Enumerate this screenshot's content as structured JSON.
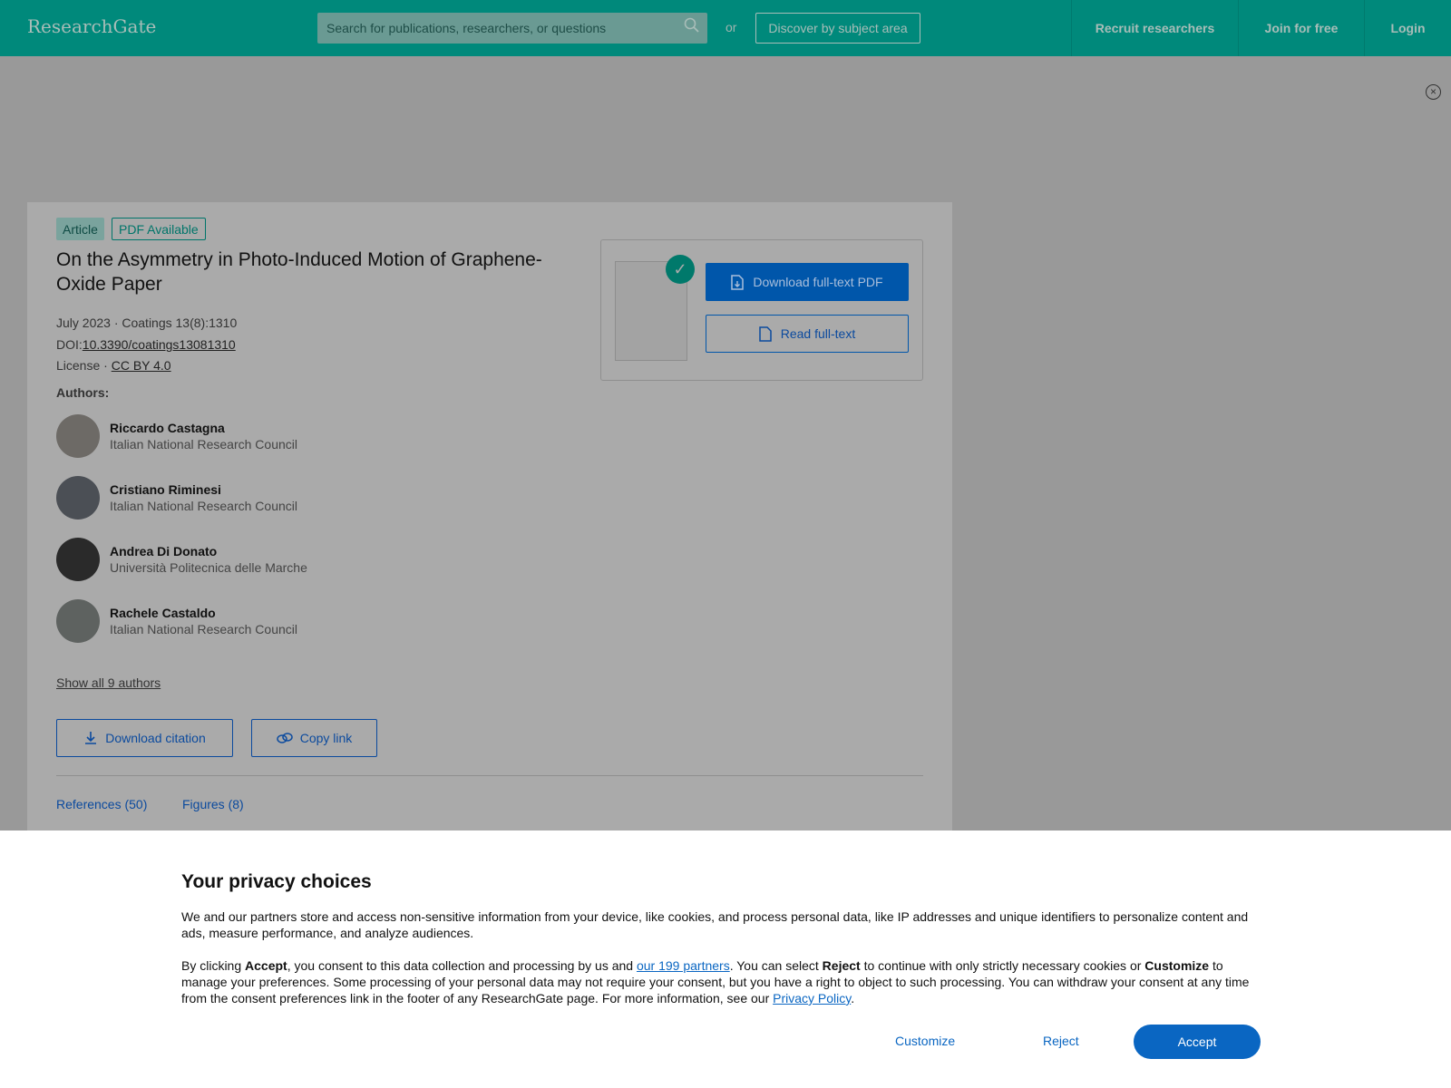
{
  "header": {
    "logo": "ResearchGate",
    "search_placeholder": "Search for publications, researchers, or questions",
    "or": "or",
    "discover": "Discover by subject area",
    "nav": [
      "Recruit researchers",
      "Join for free",
      "Login"
    ]
  },
  "article": {
    "badges": [
      "Article",
      "PDF Available"
    ],
    "title": "On the Asymmetry in Photo-Induced Motion of Graphene-Oxide Paper",
    "date_journal": "July 2023 · Coatings 13(8):1310",
    "doi_label": "DOI:",
    "doi": "10.3390/coatings13081310",
    "license_label": "License · ",
    "license": "CC BY 4.0",
    "authors_heading": "Authors:",
    "authors": [
      {
        "name": "Riccardo Castagna",
        "affiliation": "Italian National Research Council"
      },
      {
        "name": "Cristiano Riminesi",
        "affiliation": "Italian National Research Council"
      },
      {
        "name": "Andrea Di Donato",
        "affiliation": "Università Politecnica delle Marche"
      },
      {
        "name": "Rachele Castaldo",
        "affiliation": "Italian National Research Council"
      }
    ],
    "show_all": "Show all 9 authors",
    "download_citation": "Download citation",
    "copy_link": "Copy link",
    "tabs": [
      "References (50)",
      "Figures (8)"
    ],
    "download_pdf": "Download full-text PDF",
    "read_full": "Read full-text"
  },
  "consent": {
    "title": "Your privacy choices",
    "p1": "We and our partners store and access non-sensitive information from your device, like cookies, and process personal data, like IP addresses and unique identifiers to personalize content and ads, measure performance, and analyze audiences.",
    "p2a": "By clicking ",
    "accept_bold": "Accept",
    "p2b": ", you consent to this data collection and processing by us and ",
    "partners_link": "our 199 partners",
    "p2c": ". You can select ",
    "reject_bold": "Reject",
    "p2d": " to continue with only strictly necessary cookies or ",
    "customize_bold": "Customize",
    "p2e": " to manage your preferences. Some processing of your personal data may not require your consent, but you have a right to object to such processing. You can withdraw your consent at any time from the consent preferences link in the footer of any ResearchGate page. For more information, see our ",
    "privacy_link": "Privacy Policy",
    "p2f": ".",
    "customize": "Customize",
    "reject": "Reject",
    "accept": "Accept"
  },
  "colors": {
    "header": "#00897b",
    "primary": "#0a66c2",
    "teal": "#00796b"
  }
}
